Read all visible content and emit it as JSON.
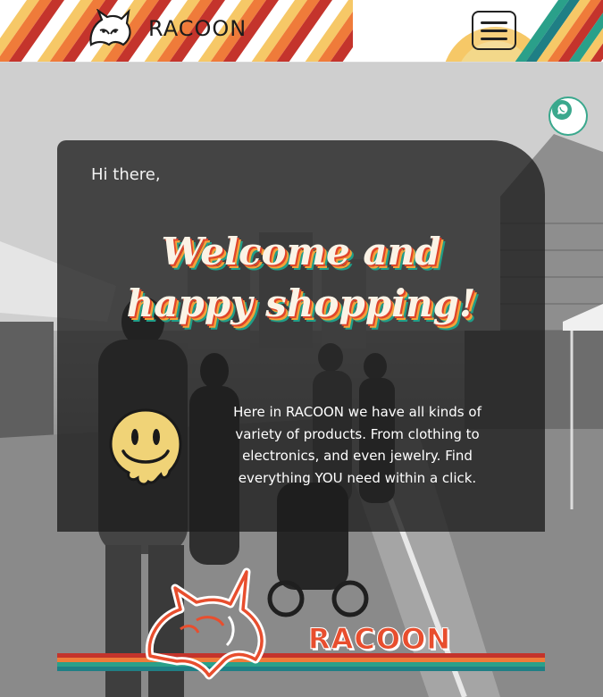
{
  "header": {
    "brand_name": "RACOON",
    "logo_icon": "fox-head-icon",
    "menu_icon": "hamburger-menu-icon"
  },
  "floating": {
    "whatsapp_icon": "whatsapp-icon"
  },
  "hero": {
    "greeting": "Hi there,",
    "headline": "Welcome and happy shopping!",
    "description": "Here in RACOON we have all kinds of variety of products. From clothing to electronics, and even jewelry. Find everything YOU need within a click.",
    "decoration_icon": "melting-smiley-icon"
  },
  "footer_logo": {
    "name": "RACOON",
    "icon": "fox-outline-logo-icon"
  },
  "colors": {
    "stripe_red": "#c4342c",
    "stripe_orange": "#ef7b3a",
    "stripe_yellow": "#f6c867",
    "stripe_green": "#2aa08a",
    "stripe_teal": "#1f7f85",
    "accent_text": "#fbf3e6"
  }
}
